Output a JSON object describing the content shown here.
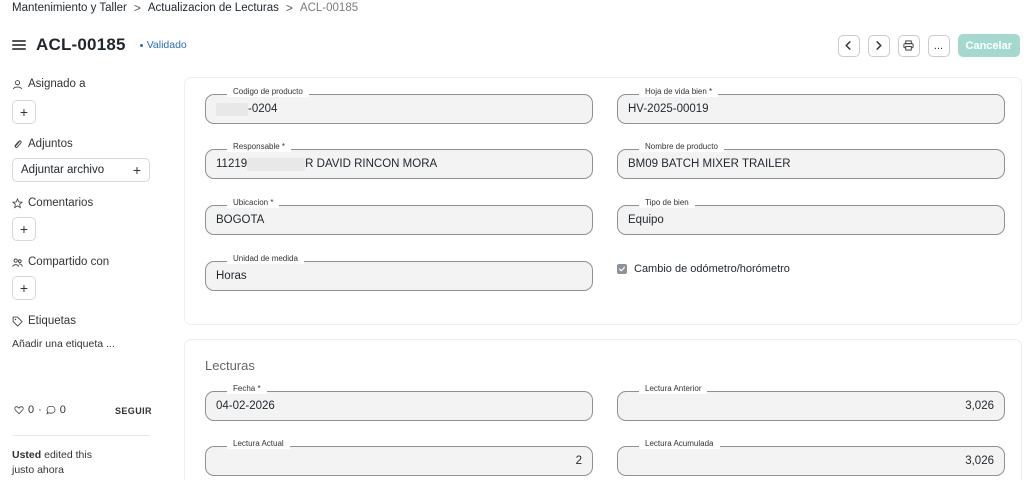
{
  "breadcrumb": {
    "items": [
      "Mantenimiento y Taller",
      "Actualizacion de Lecturas"
    ],
    "current": "ACL-00185",
    "separator": ">"
  },
  "header": {
    "title": "ACL-00185",
    "status": "Validado",
    "status_color": "#2a6ec3"
  },
  "toolbar": {
    "prev_icon": "chevron-left-icon",
    "next_icon": "chevron-right-icon",
    "print_icon": "printer-icon",
    "more_label": "...",
    "cancel_label": "Cancelar",
    "cancel_color": "#a4d9cf"
  },
  "sidebar": {
    "assigned_label": "Asignado a",
    "attachments_label": "Adjuntos",
    "attach_button_label": "Adjuntar archivo",
    "comments_label": "Comentarios",
    "shared_label": "Compartido con",
    "tags_label": "Etiquetas",
    "add_tag_label": "Añadir una etiqueta ...",
    "likes_count": "0",
    "comments_count": "0",
    "follow_label": "SEGUIR",
    "activity_user": "Usted",
    "activity_text": "edited this",
    "activity_time": "justo ahora",
    "plus": "+"
  },
  "form": {
    "codigo_producto": {
      "label": "Codigo de producto",
      "value": "-0204"
    },
    "hoja_vida": {
      "label": "Hoja de vida bien *",
      "value": "HV-2025-00019"
    },
    "responsable": {
      "label": "Responsable *",
      "value_prefix": "11219",
      "value_suffix": "R DAVID RINCON MORA"
    },
    "nombre_producto": {
      "label": "Nombre de producto",
      "value": "BM09 BATCH MIXER TRAILER"
    },
    "ubicacion": {
      "label": "Ubicacion *",
      "value": "BOGOTA"
    },
    "tipo_bien": {
      "label": "Tipo de bien",
      "value": "Equipo"
    },
    "unidad_medida": {
      "label": "Unidad de medida",
      "value": "Horas"
    },
    "cambio_odometro": {
      "label": "Cambio de odómetro/horómetro",
      "checked": true
    }
  },
  "lecturas": {
    "section_title": "Lecturas",
    "fecha": {
      "label": "Fecha *",
      "value": "04-02-2026"
    },
    "lectura_anterior": {
      "label": "Lectura Anterior",
      "value": "3,026"
    },
    "lectura_actual": {
      "label": "Lectura Actual",
      "value": "2"
    },
    "lectura_acumulada": {
      "label": "Lectura Acumulada",
      "value": "3,026"
    }
  }
}
